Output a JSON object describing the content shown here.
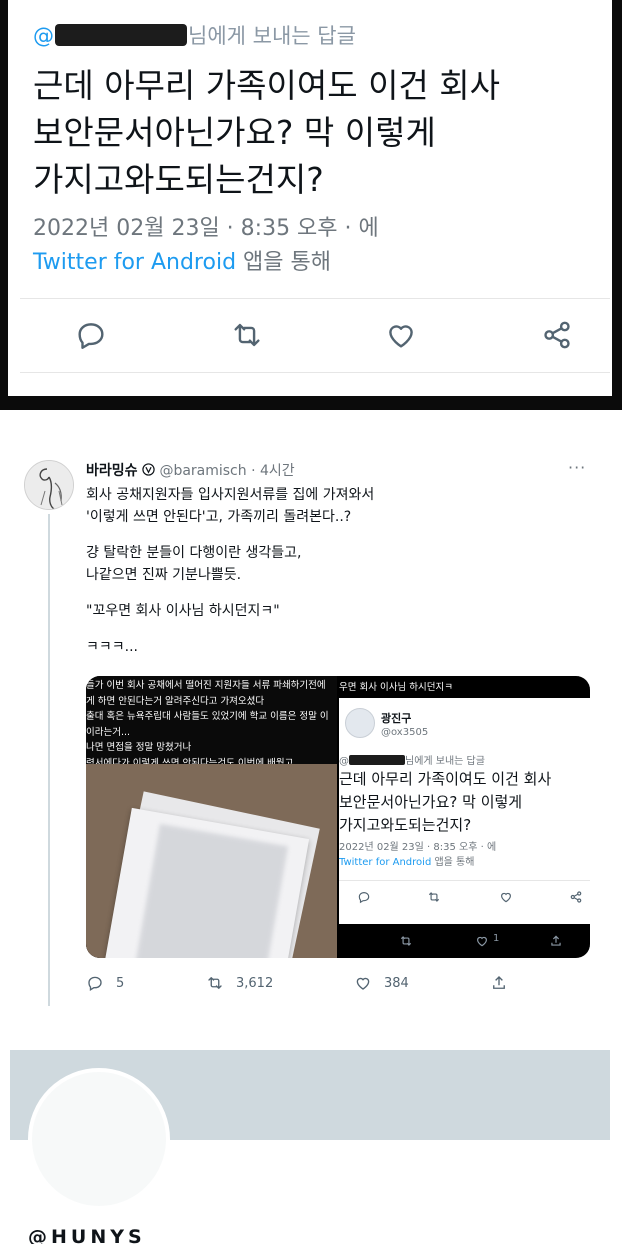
{
  "colors": {
    "link": "#1d9bf0",
    "muted": "#6e767d",
    "text": "#0f1419",
    "banner": "#cfd9de"
  },
  "top_tweet": {
    "reply_at": "@",
    "reply_suffix": "님에게 보내는 답글",
    "body_line1": "근데 아무리 가족이여도 이건 회사",
    "body_line2": "보안문서아닌가요? 막 이렇게",
    "body_line3": "가지고와도되는건지?",
    "timestamp": "2022년 02월 23일 · 8:35 오후 · 에",
    "source_link": "Twitter for Android",
    "source_suffix": " 앱을 통해",
    "actions": [
      "reply-icon",
      "retweet-icon",
      "like-icon",
      "share-icon"
    ]
  },
  "tweet": {
    "display_name": "바라밍슈",
    "handle": "@baramisch",
    "time": " · 4시간",
    "more": "···",
    "lines": [
      "회사 공채지원자들 입사지원서류를 집에 가져와서",
      "'이렇게 쓰면 안된다'고, 가족끼리 돌려본다..?",
      "걍 탈락한 분들이 다행이란 생각들고,",
      "나같으면 진짜 기분나쁠듯.",
      "\"꼬우면 회사 이사님 하시던지ㅋ\"",
      "ㅋㅋㅋ..."
    ],
    "media_left_lines": [
      "들가 이번 회사 공채에서 떨어진 지원자들 서류 파쇄하기전에",
      "게 하면 안된다는거 알려주신다고 가져오셨다",
      "출대 혹은 뉴욕주립대 사람들도 있었기에 학교 이름은 정말 이",
      "이라는거...",
      "나면 면접을 정말 망쳤거나",
      "력서에다가 이렇게 쓰면 안된다는것도 이번에 배웠고"
    ],
    "media_right": {
      "top_text": "우면 회사 이사님 하시던지ㅋ",
      "name": "광진구",
      "handle": "@ox3505",
      "reply_at": "@",
      "reply_suffix": "님에게 보내는 답글",
      "body_line1": "근데 아무리 가족이여도 이건 회사",
      "body_line2": "보안문서아닌가요? 막 이렇게",
      "body_line3": "가지고와도되는건지?",
      "timestamp": "2022년 02월 23일 · 8:35 오후 · 에",
      "source_link": "Twitter for Android",
      "source_suffix": " 앱을 통해",
      "bottom_like_count": "1"
    },
    "reply_count": "5",
    "retweet_count": "3,612",
    "like_count": "384"
  },
  "profile": {
    "handle": "@HUNYS"
  }
}
